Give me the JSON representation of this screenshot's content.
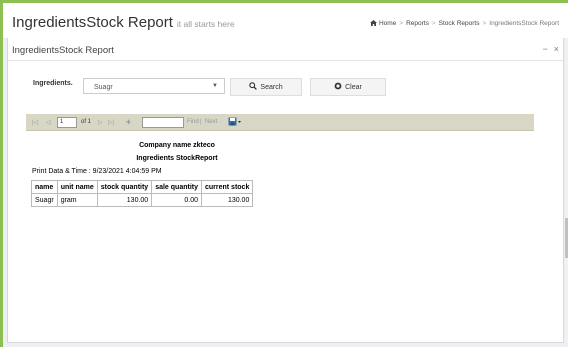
{
  "header": {
    "title": "IngredientsStock Report",
    "subtitle": "it all starts here",
    "breadcrumb": [
      "Home",
      "Reports",
      "Stock Reports",
      "IngredientsStock Report"
    ]
  },
  "panel": {
    "title": "IngredientsStock Report",
    "minimize_label": "−",
    "close_label": "×"
  },
  "filter": {
    "label": "Ingredients.",
    "selected": "Suagr",
    "search_label": "Search",
    "clear_label": "Clear"
  },
  "toolbar": {
    "first": "|◁",
    "prev": "◁",
    "page": "1",
    "of_label": "of 1",
    "next": "▷",
    "last": "▷|",
    "refresh": "✚",
    "find_label": "Find",
    "sep": "|",
    "next_label": "Next"
  },
  "report": {
    "company": "Company name zkteco",
    "title": "Ingredients StockReport",
    "print_line": "Print Data & Time : 9/23/2021 4:04:59 PM",
    "columns": [
      "name",
      "unit name",
      "stock quantity",
      "sale quantity",
      "current stock"
    ],
    "rows": [
      [
        "Suagr",
        "gram",
        "130.00",
        "0.00",
        "130.00"
      ]
    ]
  },
  "colors": {
    "accent": "#8cc152",
    "toolbar": "#d8d6c4"
  }
}
